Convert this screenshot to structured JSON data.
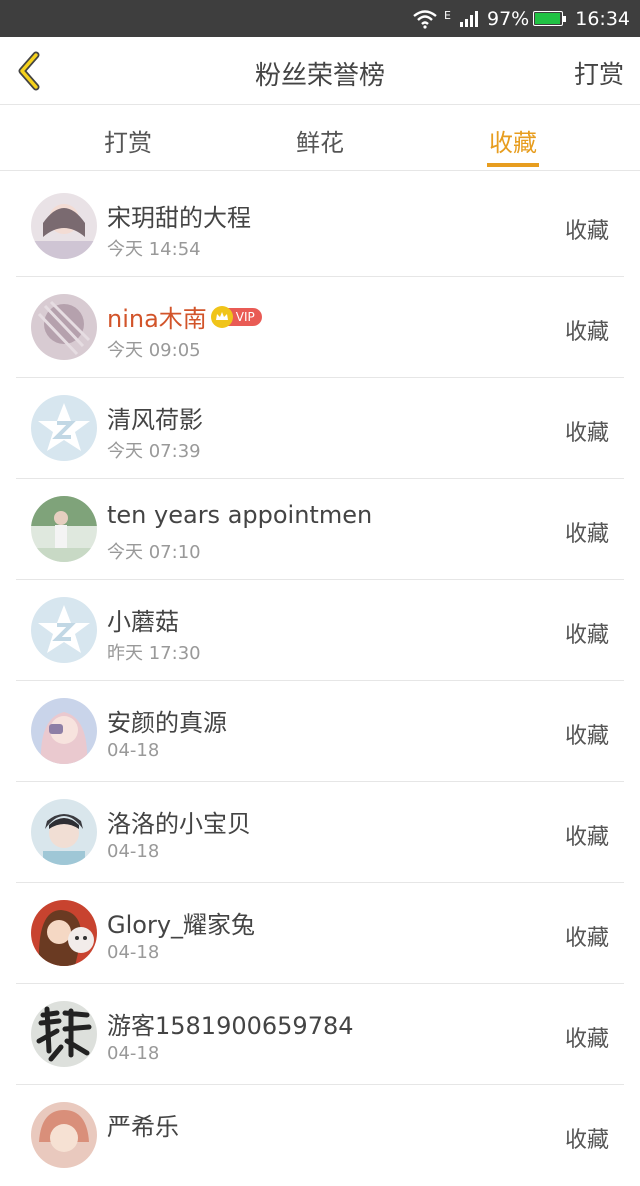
{
  "status_bar": {
    "network": "E",
    "battery_text": "97%",
    "battery_level": 0.97,
    "time": "16:34",
    "battery_color": "#21c244"
  },
  "header": {
    "back_icon": "chevron-left-icon",
    "title": "粉丝荣誉榜",
    "action": "打赏",
    "accent_color": "#e79d1f"
  },
  "tabs": [
    {
      "label": "打赏",
      "active": false
    },
    {
      "label": "鲜花",
      "active": false
    },
    {
      "label": "收藏",
      "active": true
    }
  ],
  "fans": [
    {
      "name": "宋玥甜的大程",
      "time": "今天 14:54",
      "action": "收藏",
      "vip": false
    },
    {
      "name": "nina木南",
      "time": "今天 09:05",
      "action": "收藏",
      "vip": true,
      "badge": "VIP"
    },
    {
      "name": "清风荷影",
      "time": "今天 07:39",
      "action": "收藏",
      "vip": false
    },
    {
      "name": "ten years appointmen",
      "time": "今天 07:10",
      "action": "收藏",
      "vip": false
    },
    {
      "name": "小蘑菇",
      "time": "昨天 17:30",
      "action": "收藏",
      "vip": false
    },
    {
      "name": "安颜的真源",
      "time": "04-18",
      "action": "收藏",
      "vip": false
    },
    {
      "name": "洛洛的小宝贝",
      "time": "04-18",
      "action": "收藏",
      "vip": false
    },
    {
      "name": "Glory_耀家兔",
      "time": "04-18",
      "action": "收藏",
      "vip": false
    },
    {
      "name": "游客1581900659784",
      "time": "04-18",
      "action": "收藏",
      "vip": false
    },
    {
      "name": "严希乐",
      "time": "",
      "action": "收藏",
      "vip": false
    }
  ]
}
